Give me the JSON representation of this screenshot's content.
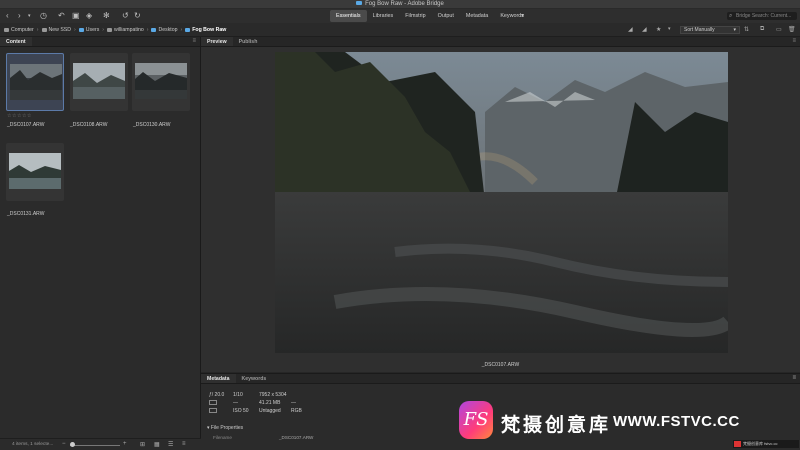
{
  "window": {
    "title": "Fog Bow Raw - Adobe Bridge"
  },
  "workspaces": [
    {
      "label": "Essentials",
      "active": true
    },
    {
      "label": "Libraries",
      "active": false
    },
    {
      "label": "Filmstrip",
      "active": false
    },
    {
      "label": "Output",
      "active": false
    },
    {
      "label": "Metadata",
      "active": false
    },
    {
      "label": "Keywords",
      "active": false
    }
  ],
  "search": {
    "placeholder": "Bridge Search: Current..."
  },
  "breadcrumbs": [
    {
      "label": "Computer",
      "icon": "computer-icon"
    },
    {
      "label": "New SSD",
      "icon": "drive-icon"
    },
    {
      "label": "Users",
      "icon": "folder-icon"
    },
    {
      "label": "williampatino",
      "icon": "home-icon"
    },
    {
      "label": "Desktop",
      "icon": "folder-icon"
    },
    {
      "label": "Fog Bow Raw",
      "icon": "folder-icon"
    }
  ],
  "sort": {
    "label": "Sort Manually"
  },
  "content_panel": {
    "tab": "Content",
    "thumbnails": [
      {
        "filename": "_DSC0107.ARW",
        "selected": true
      },
      {
        "filename": "_DSC0108.ARW",
        "selected": false
      },
      {
        "filename": "_DSC0130.ARW",
        "selected": false
      },
      {
        "filename": "_DSC0131.ARW",
        "selected": false
      }
    ],
    "rating": "☆☆☆☆☆",
    "status": "4 items, 1 selecte..."
  },
  "preview_panel": {
    "tabs": [
      "Preview",
      "Publish"
    ],
    "caption": "_DSC0107.ARW"
  },
  "metadata_panel": {
    "tabs": [
      "Metadata",
      "Keywords"
    ],
    "aperture": "ƒ/ 20.0",
    "shutter": "1/10",
    "dimensions": "7952 x 5304",
    "dash1": "—",
    "file_size": "41.21 MB",
    "dash2": "—",
    "iso": "ISO 50",
    "label": "Untagged",
    "color_mode": "RGB",
    "section": "File Properties",
    "field_name": "Filename",
    "field_value": "_DSC0107.ARW"
  },
  "watermark": {
    "logo": "FS",
    "chinese": "梵摄创意库",
    "url": "WWW.FSTVC.CC",
    "badge": "梵摄创意库 fstvc.cc"
  }
}
